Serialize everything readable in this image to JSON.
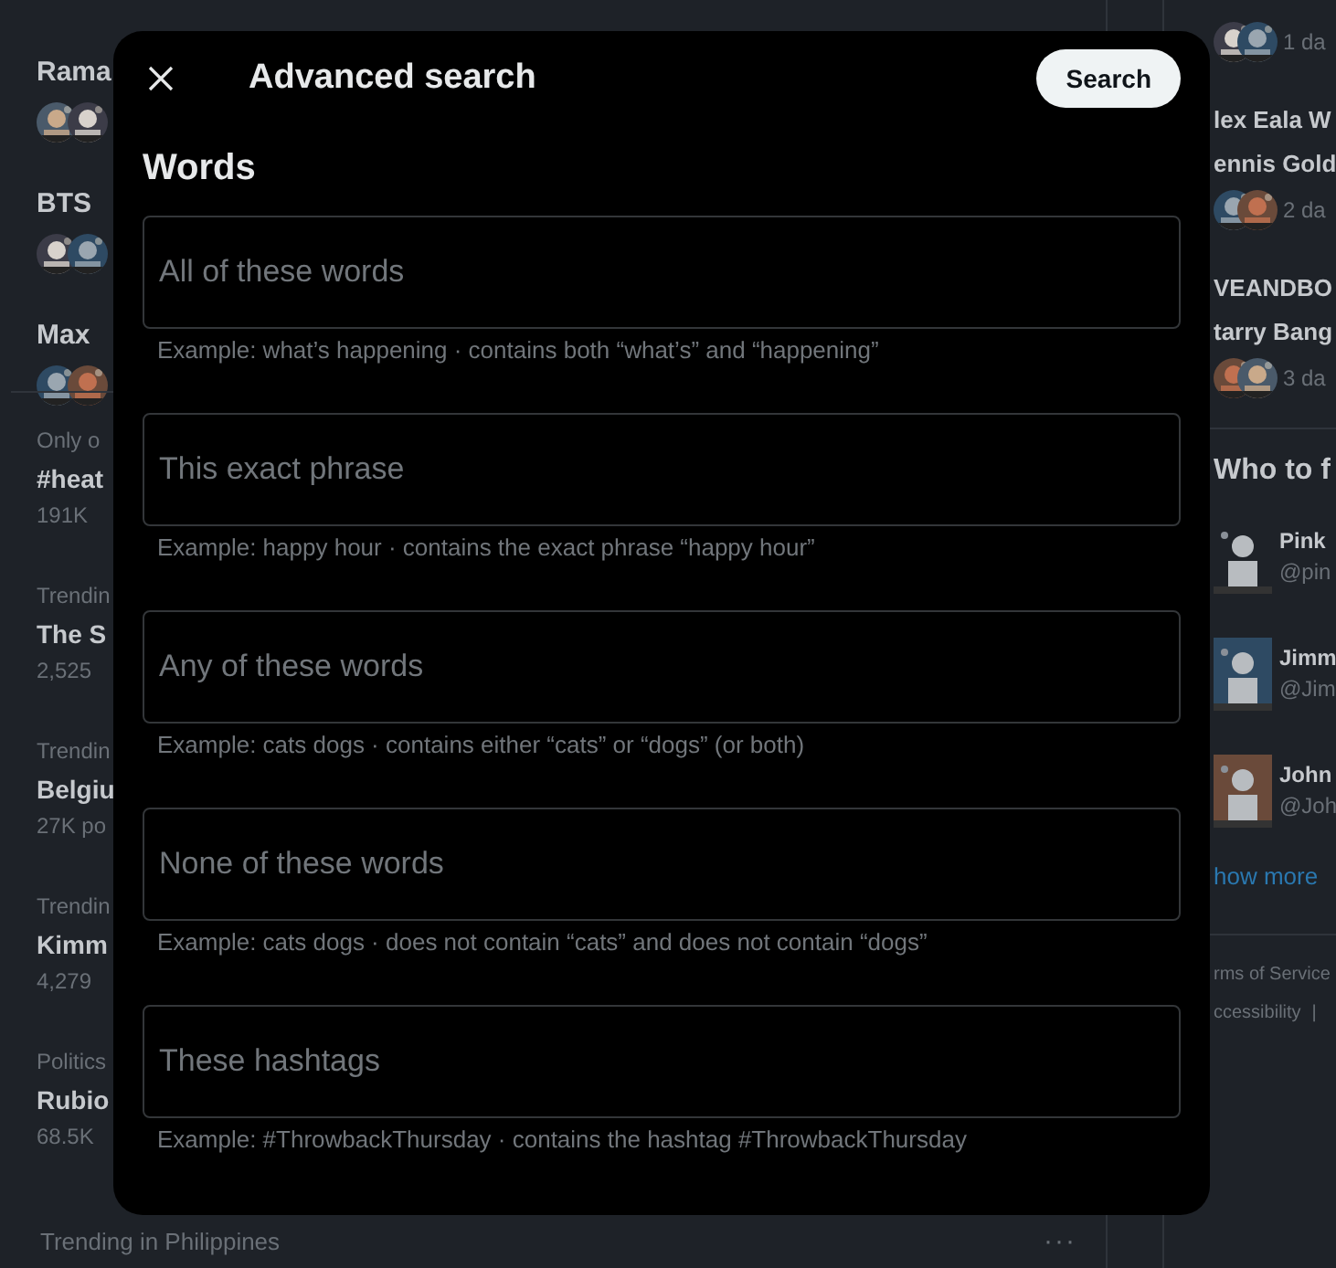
{
  "background": {
    "news": [
      {
        "title": "Rama"
      },
      {
        "title": "BTS"
      },
      {
        "title": "Max"
      }
    ],
    "trends": [
      {
        "context": "Only o",
        "name": "#heat",
        "count": "191K"
      },
      {
        "context": "Trendin",
        "name": "The S",
        "count": "2,525"
      },
      {
        "context": "Trendin",
        "name": "Belgiu",
        "count": "27K po"
      },
      {
        "context": "Trendin",
        "name": "Kimm",
        "count": "4,279"
      },
      {
        "context": "Politics",
        "name": "Rubio",
        "count": "68.5K"
      }
    ],
    "last_trend": {
      "context": "Trending in Philippines",
      "more": "···"
    },
    "side_news": [
      {
        "time": "1 da"
      },
      {
        "lines": [
          "lex Eala W",
          "ennis Gold"
        ],
        "time": "2 da"
      },
      {
        "lines": [
          "VEANDBO",
          "tarry Bang"
        ],
        "time": "3 da"
      }
    ],
    "who_to_follow": {
      "title": "Who to f",
      "people": [
        {
          "name": "Pink",
          "handle": "@pin"
        },
        {
          "name": "Jimm",
          "handle": "@Jim"
        },
        {
          "name": "John",
          "handle": "@Joh"
        }
      ],
      "show_more": "how more"
    },
    "footer": [
      "rms of Service",
      "ccessibility",
      "|"
    ]
  },
  "dialog": {
    "title": "Advanced search",
    "action": "Search",
    "section": "Words",
    "fields": [
      {
        "placeholder": "All of these words",
        "hint": "Example: what’s happening · contains both “what’s” and “happening”"
      },
      {
        "placeholder": "This exact phrase",
        "hint": "Example: happy hour · contains the exact phrase “happy hour”"
      },
      {
        "placeholder": "Any of these words",
        "hint": "Example: cats dogs · contains either “cats” or “dogs” (or both)"
      },
      {
        "placeholder": "None of these words",
        "hint": "Example: cats dogs · does not contain “cats” and does not contain “dogs”"
      },
      {
        "placeholder": "These hashtags",
        "hint": "Example: #ThrowbackThursday · contains the hashtag #ThrowbackThursday"
      }
    ]
  }
}
